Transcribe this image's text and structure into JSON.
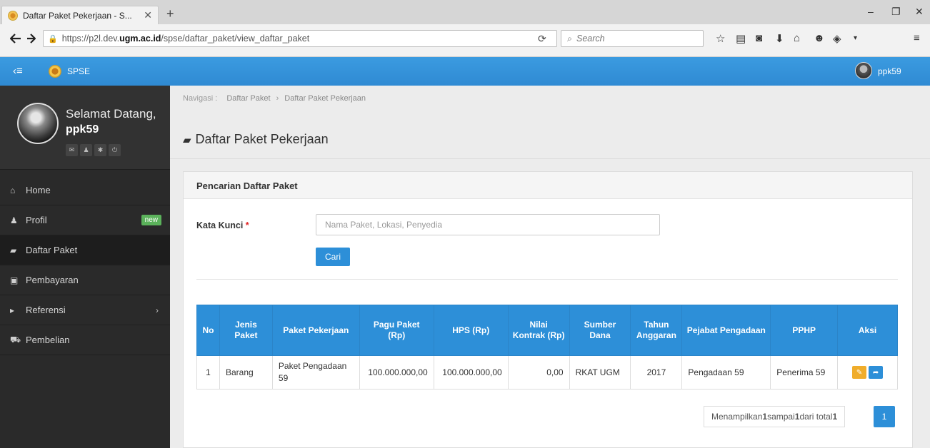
{
  "browser": {
    "tab_title": "Daftar Paket Pekerjaan - S...",
    "tab_close": "✕",
    "new_tab": "+",
    "url_prefix": "https://p2l.dev.",
    "url_domain": "ugm.ac.id",
    "url_path": "/spse/daftar_paket/view_daftar_paket",
    "search_placeholder": "Search",
    "win_min": "–",
    "win_max": "❐",
    "win_close": "✕"
  },
  "appbar": {
    "brand": "SPSE",
    "username": "ppk59"
  },
  "sidebar": {
    "welcome": "Selamat Datang,",
    "username": "ppk59",
    "items": [
      {
        "label": "Home",
        "icon": "home-icon"
      },
      {
        "label": "Profil",
        "icon": "user-icon",
        "badge": "new"
      },
      {
        "label": "Daftar Paket",
        "icon": "book-icon"
      },
      {
        "label": "Pembayaran",
        "icon": "money-icon"
      },
      {
        "label": "Referensi",
        "icon": "caret-right-icon"
      },
      {
        "label": "Pembelian",
        "icon": "cart-icon"
      }
    ]
  },
  "breadcrumb": {
    "prefix": "Navigasi :",
    "items": [
      "Daftar Paket",
      "Daftar Paket Pekerjaan"
    ]
  },
  "page": {
    "title": "Daftar Paket Pekerjaan"
  },
  "search_panel": {
    "heading": "Pencarian Daftar Paket",
    "keyword_label": "Kata Kunci",
    "required_mark": "*",
    "keyword_placeholder": "Nama Paket, Lokasi, Penyedia",
    "keyword_value": "",
    "search_button": "Cari"
  },
  "table": {
    "headers": [
      "No",
      "Jenis Paket",
      "Paket Pekerjaan",
      "Pagu Paket (Rp)",
      "HPS (Rp)",
      "Nilai Kontrak (Rp)",
      "Sumber Dana",
      "Tahun Anggaran",
      "Pejabat Pengadaan",
      "PPHP",
      "Aksi"
    ],
    "rows": [
      {
        "no": "1",
        "jenis": "Barang",
        "paket": "Paket Pengadaan 59",
        "pagu": "100.000.000,00",
        "hps": "100.000.000,00",
        "nilai": "0,00",
        "sumber": "RKAT UGM",
        "tahun": "2017",
        "pejabat": "Pengadaan 59",
        "pphp": "Penerima 59"
      }
    ]
  },
  "pager": {
    "info_prefix": "Menampilkan ",
    "from": "1",
    "mid1": " sampai ",
    "to": "1",
    "mid2": " dari total ",
    "total": "1",
    "current_page": "1"
  }
}
